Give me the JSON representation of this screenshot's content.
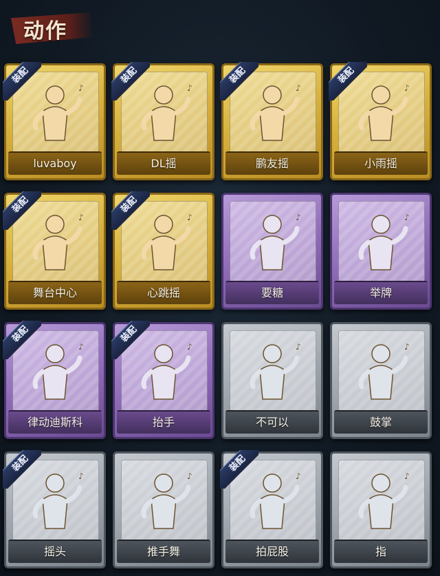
{
  "header": {
    "title": "动作"
  },
  "equip_label": "装配",
  "cards": [
    {
      "label": "luvaboy",
      "tier": "gold",
      "equipped": true,
      "icon": "dance-pose-icon"
    },
    {
      "label": "DL摇",
      "tier": "gold",
      "equipped": true,
      "icon": "music-dance-icon"
    },
    {
      "label": "鹏友摇",
      "tier": "gold",
      "equipped": true,
      "icon": "arms-cross-icon"
    },
    {
      "label": "小雨摇",
      "tier": "gold",
      "equipped": true,
      "icon": "music-dance-icon"
    },
    {
      "label": "舞台中心",
      "tier": "gold",
      "equipped": true,
      "icon": "sparkle-pose-icon"
    },
    {
      "label": "心跳摇",
      "tier": "gold",
      "equipped": true,
      "icon": "hand-raise-icon"
    },
    {
      "label": "要糖",
      "tier": "purple",
      "equipped": false,
      "icon": "reach-out-icon"
    },
    {
      "label": "举牌",
      "tier": "purple",
      "equipped": false,
      "icon": "hold-sign-icon"
    },
    {
      "label": "律动迪斯科",
      "tier": "purple",
      "equipped": true,
      "icon": "disco-point-icon"
    },
    {
      "label": "抬手",
      "tier": "purple",
      "equipped": true,
      "icon": "wave-hand-icon"
    },
    {
      "label": "不可以",
      "tier": "silver",
      "equipped": false,
      "icon": "finger-wag-icon"
    },
    {
      "label": "鼓掌",
      "tier": "silver",
      "equipped": false,
      "icon": "clap-icon"
    },
    {
      "label": "摇头",
      "tier": "silver",
      "equipped": true,
      "icon": "shake-head-icon"
    },
    {
      "label": "推手舞",
      "tier": "silver",
      "equipped": false,
      "icon": "push-hands-icon"
    },
    {
      "label": "拍屁股",
      "tier": "silver",
      "equipped": true,
      "icon": "bend-pose-icon"
    },
    {
      "label": "指",
      "tier": "silver",
      "equipped": false,
      "icon": "point-hand-icon"
    }
  ]
}
